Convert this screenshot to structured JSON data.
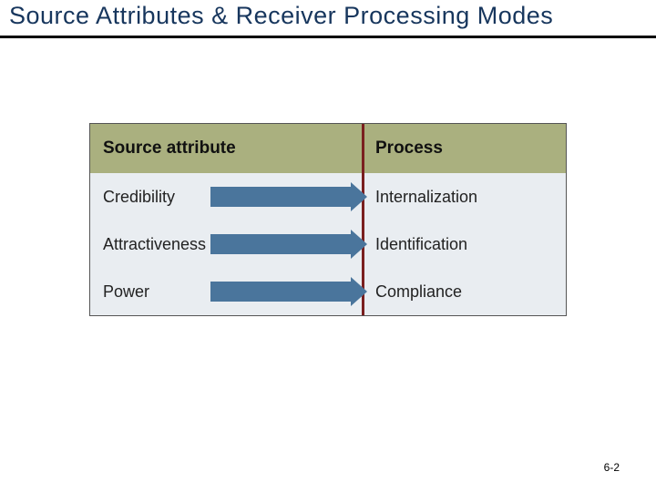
{
  "title": "Source Attributes & Receiver Processing Modes",
  "table": {
    "header": {
      "left": "Source attribute",
      "right": "Process"
    },
    "rows": [
      {
        "left": "Credibility",
        "right": "Internalization"
      },
      {
        "left": "Attractiveness",
        "right": "Identification"
      },
      {
        "left": "Power",
        "right": "Compliance"
      }
    ]
  },
  "page_number": "6-2"
}
